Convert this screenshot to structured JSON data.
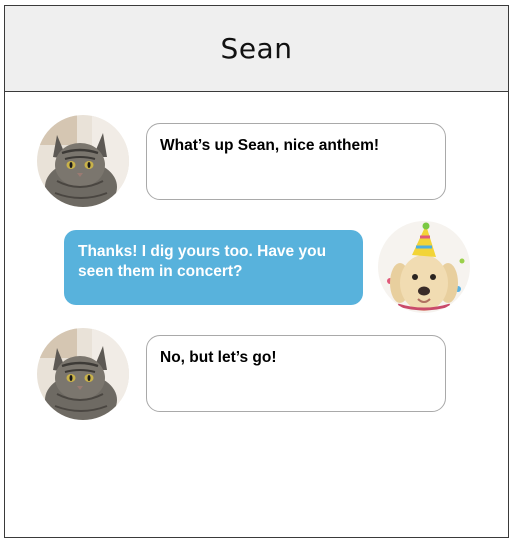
{
  "header": {
    "title": "Sean"
  },
  "messages": [
    {
      "sender": "contact",
      "avatar": "cat-avatar",
      "text": "What’s up Sean, nice anthem!"
    },
    {
      "sender": "me",
      "avatar": "dog-party-hat-avatar",
      "text": "Thanks! I dig yours too. Have you seen them in concert?"
    },
    {
      "sender": "contact",
      "avatar": "cat-avatar",
      "text": "No, but let’s go!"
    }
  ],
  "colors": {
    "header_bg": "#efefef",
    "outgoing_bubble": "#58b2dc",
    "incoming_border": "#a9a9a9"
  }
}
